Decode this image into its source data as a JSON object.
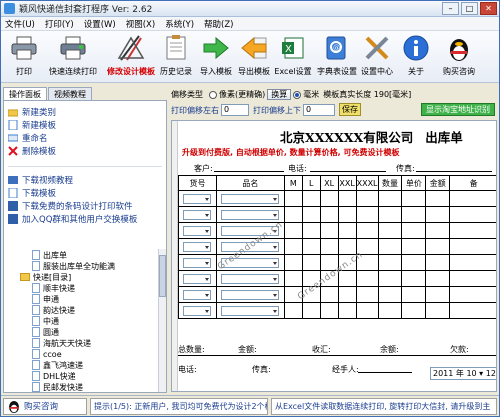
{
  "app": {
    "title": "颖风快递信封套打程序 Ver: 2.62"
  },
  "menu": [
    "文件(U)",
    "打印(Y)",
    "设置(W)",
    "视图(X)",
    "系统(Y)",
    "帮助(Z)"
  ],
  "toolbar": [
    {
      "label": "打印",
      "icon": "printer-icon"
    },
    {
      "label": "快速连续打印",
      "icon": "printer-batch-icon"
    },
    {
      "label": "修改设计模板",
      "icon": "design-tools-icon",
      "highlight": true
    },
    {
      "label": "历史记录",
      "icon": "history-icon"
    },
    {
      "label": "导入模板",
      "icon": "import-arrow-icon"
    },
    {
      "label": "导出模板",
      "icon": "export-arrow-icon"
    },
    {
      "label": "Excel设置",
      "icon": "excel-icon"
    },
    {
      "label": "字典表设置",
      "icon": "address-book-icon"
    },
    {
      "label": "设置中心",
      "icon": "wrench-icon"
    },
    {
      "label": "关于",
      "icon": "info-icon"
    },
    {
      "label": "购买咨询",
      "icon": "qq-penguin-icon"
    }
  ],
  "tabs": [
    "操作面板",
    "视频教程"
  ],
  "sidebar": {
    "group1": [
      "新建类别",
      "新建模板",
      "重命名",
      "删除模板"
    ],
    "group2": [
      "下载视频教程",
      "下载模板",
      "下载免费的条码设计打印软件",
      "加入QQ群和其他用户交换模板"
    ],
    "tree": [
      "出库单",
      "服装出库单全功能满",
      "快递[目录]",
      "顺丰快递",
      "申通",
      "韵达快递",
      "中通",
      "圆通",
      "海航天天快递",
      "ccoe",
      "鑫飞鸿速递",
      "DHL快递",
      "民邮发快递"
    ]
  },
  "controls": {
    "offset_type_label": "偏移类型",
    "opt_pixel": "像素(更精确)",
    "switch": "换算",
    "opt_mm": "毫米",
    "paper_len": "模板真实长度 190[毫米]",
    "print_offset_lr": "打印偏移左右",
    "offset_lr_value": "0",
    "print_offset_ud": "打印偏移上下",
    "offset_ud_value": "0",
    "save": "保存",
    "taobao_btn": "显示淘宝地址识别"
  },
  "form": {
    "company": "北京XXXXXX有限公司",
    "doc_title": "出库单",
    "subtitle": "升级到付费版, 自动根据单价, 数量计算价格, 可免费设计模板",
    "customer": "客户:",
    "phone": "电话:",
    "fax": "传真:",
    "columns": [
      "货号",
      "品名",
      "M",
      "L",
      "XL",
      "XXL",
      "XXXL",
      "数量",
      "单价",
      "金额",
      "备"
    ],
    "rows": 8,
    "total_qty": "总数量:",
    "amount": "金额:",
    "received": "收汇:",
    "balance": "余额:",
    "arrears": "欠款:",
    "phone2": "电话:",
    "fax2": "传真:",
    "handler": "经手人:",
    "date_year": "2011",
    "date_month": "10",
    "date_day": "12"
  },
  "watermark": "Greendown.cn",
  "status": {
    "buy": "购买咨询",
    "tip": "提示(1/5): 正新用户, 我司均可免费代为设计2个模板",
    "info": "从Excel文件读取数据连续打印, 旋转打印大信封, 请升级到主"
  }
}
